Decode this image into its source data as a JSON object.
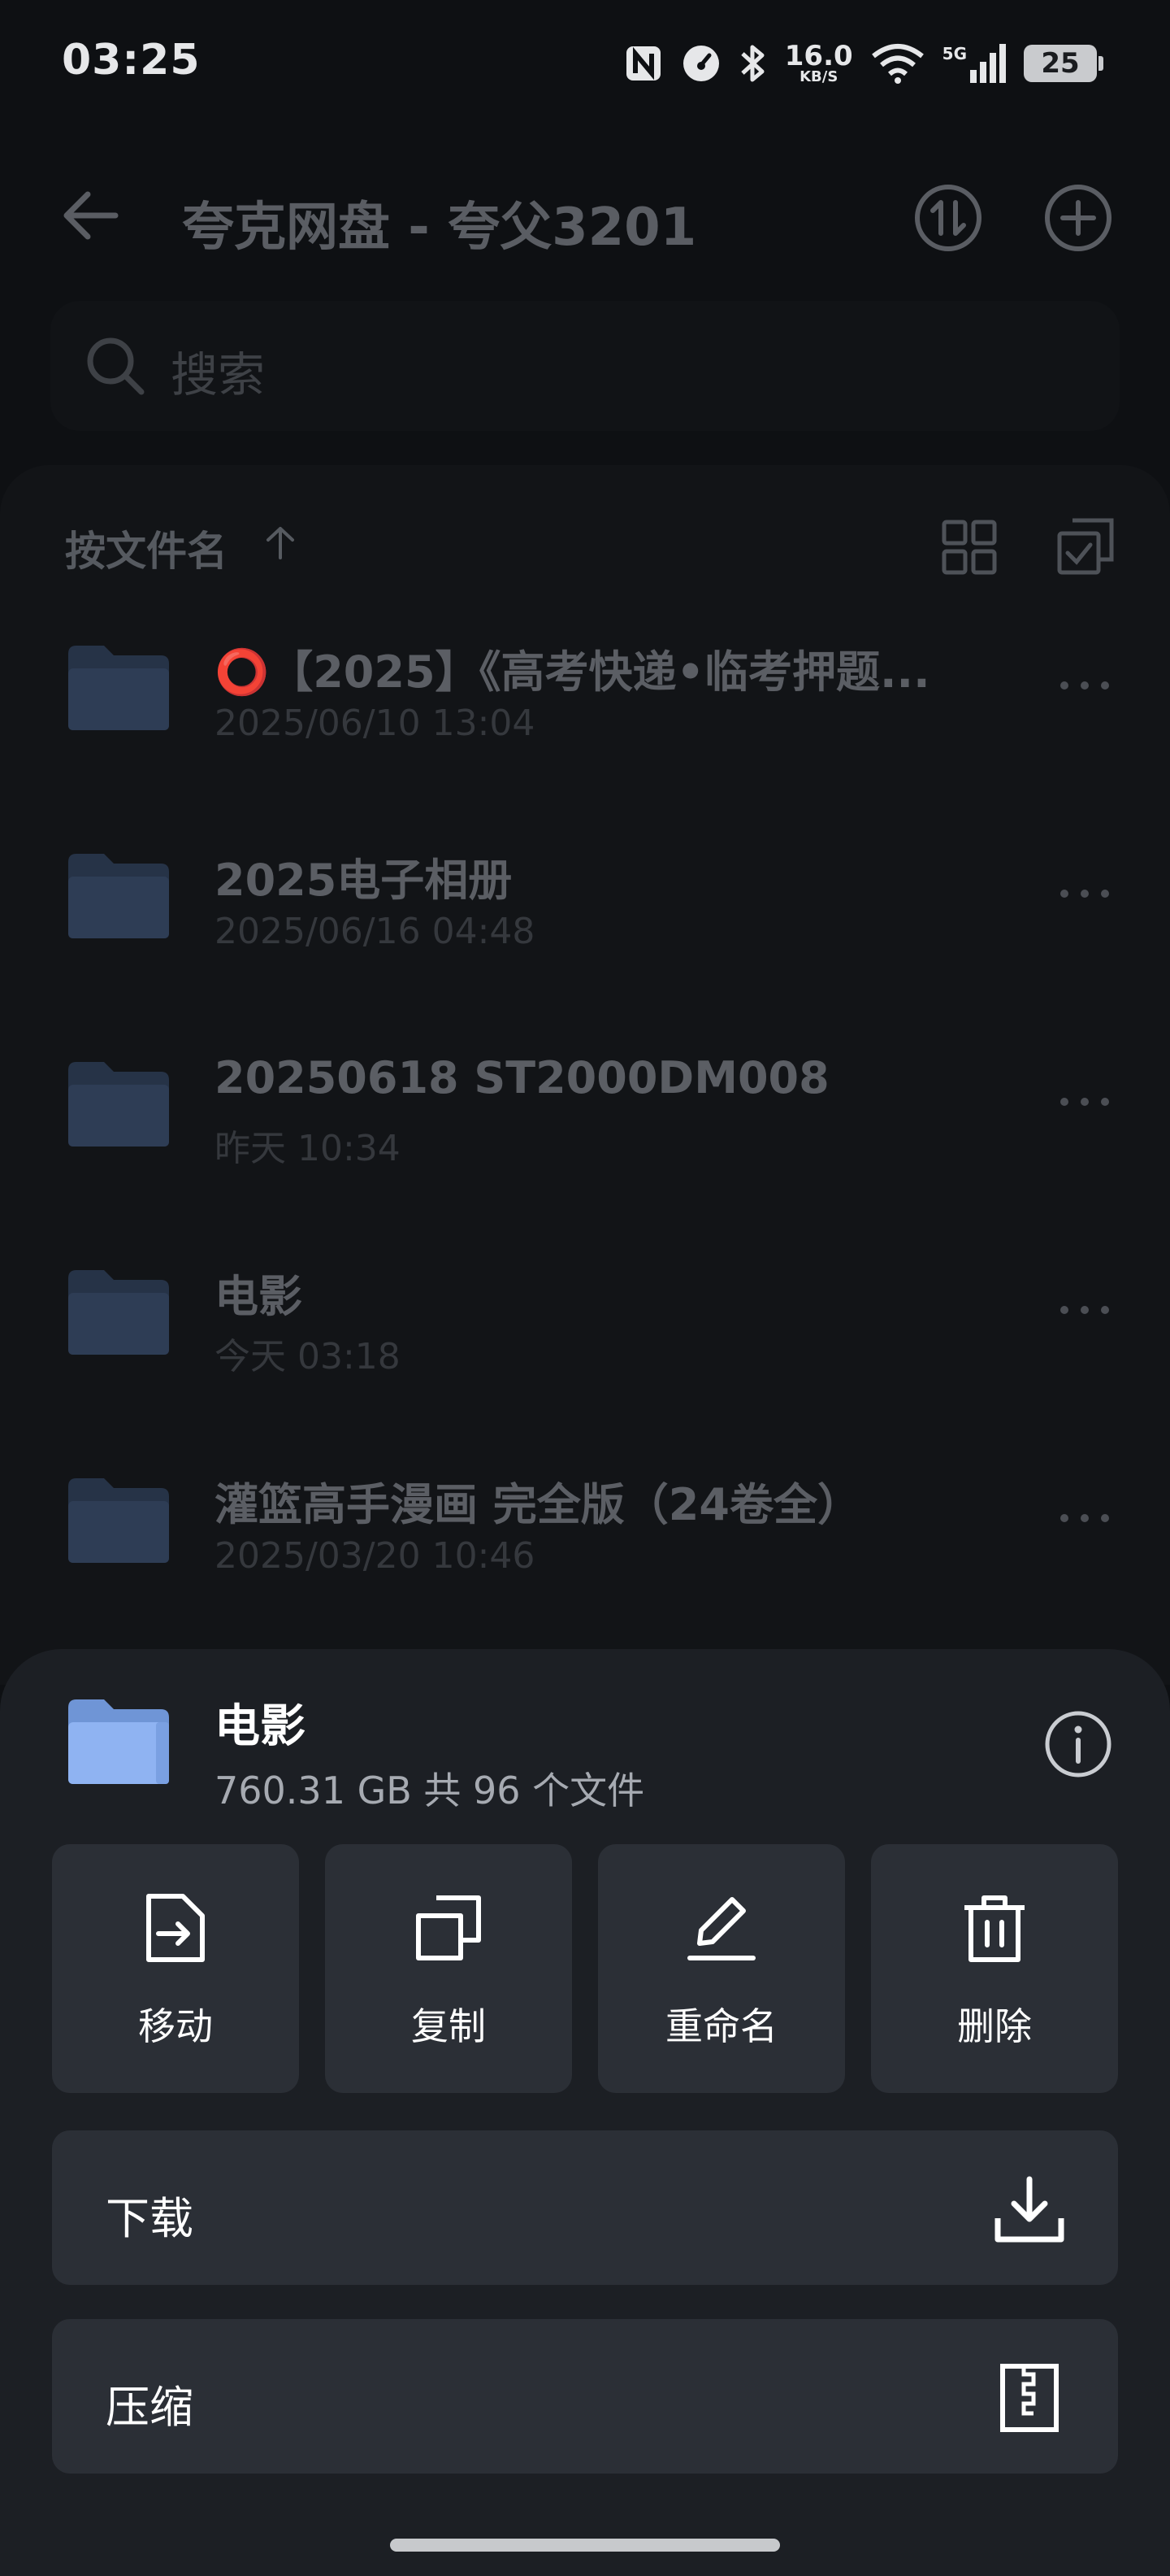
{
  "status_bar": {
    "time": "03:25",
    "net_speed_value": "16.0",
    "net_speed_unit": "KB/S",
    "signal_label": "5G",
    "battery": "25"
  },
  "header": {
    "title": "夸克网盘 - 夸父3201"
  },
  "search": {
    "placeholder": "搜索"
  },
  "list": {
    "sort_label": "按文件名",
    "files": [
      {
        "name": "⭕【2025】《高考快递•临考押题...",
        "date": "2025/06/10 13:04"
      },
      {
        "name": "2025电子相册",
        "date": "2025/06/16 04:48"
      },
      {
        "name": "20250618 ST2000DM008",
        "date": "昨天 10:34"
      },
      {
        "name": "电影",
        "date": "今天 03:18"
      },
      {
        "name": "灌篮高手漫画 完全版（24卷全）",
        "date": "2025/03/20 10:46"
      }
    ]
  },
  "sheet": {
    "title": "电影",
    "meta": "760.31 GB 共 96 个文件",
    "actions": [
      {
        "label": "移动",
        "icon": "move-icon"
      },
      {
        "label": "复制",
        "icon": "copy-icon"
      },
      {
        "label": "重命名",
        "icon": "rename-icon"
      },
      {
        "label": "删除",
        "icon": "delete-icon"
      }
    ],
    "download_label": "下载",
    "compress_label": "压缩"
  },
  "colors": {
    "background": "#0e1013",
    "sheet": "#1c1f24",
    "button": "#2b2f36",
    "folder_blue": "#8fb3f2"
  }
}
